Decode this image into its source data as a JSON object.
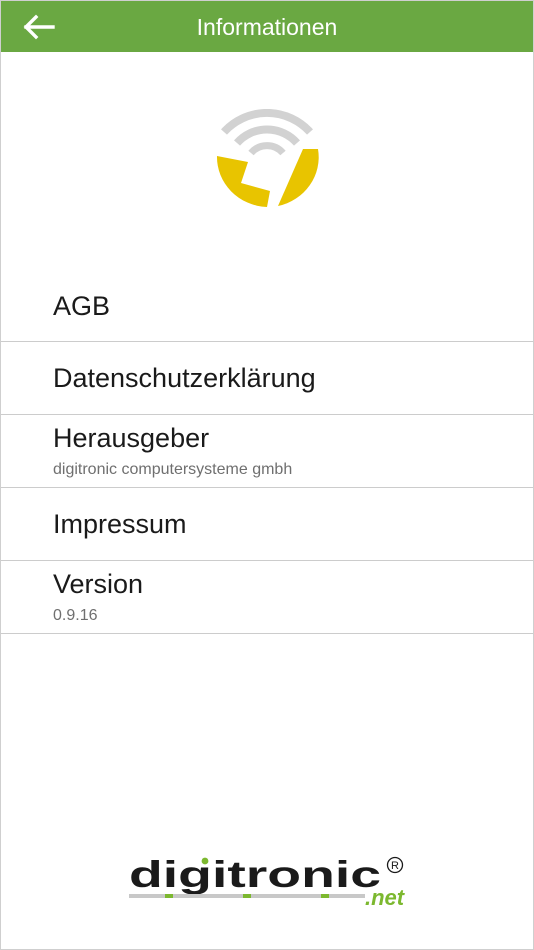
{
  "appbar": {
    "title": "Informationen",
    "back_icon": "arrow-left-icon",
    "background_color": "#6aa842"
  },
  "app_logo": {
    "icon": "wifi-pie-logo",
    "accent_color": "#e8c400",
    "signal_color": "#d2d2d2"
  },
  "list": {
    "agb": {
      "title": "AGB"
    },
    "privacy": {
      "title": "Datenschutzerklärung"
    },
    "publisher": {
      "title": "Herausgeber",
      "subtitle": "digitronic computersysteme gmbh"
    },
    "imprint": {
      "title": "Impressum"
    },
    "version": {
      "title": "Version",
      "subtitle": "0.9.16"
    }
  },
  "brand": {
    "name": "digitronic",
    "suffix": ".net",
    "registered": "®",
    "accent_color": "#7cb82f"
  }
}
